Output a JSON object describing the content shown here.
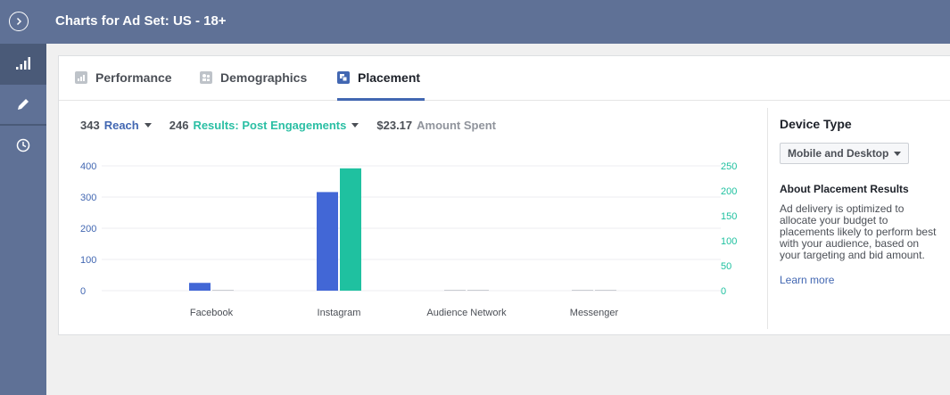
{
  "header": {
    "title": "Charts for Ad Set: US - 18+",
    "toggle_icon": "chevron-right-circle-icon"
  },
  "sidebar": {
    "items": [
      {
        "icon": "bar-chart-icon",
        "active": true
      },
      {
        "icon": "pencil-icon",
        "active": false
      },
      {
        "icon": "clock-icon",
        "active": false
      }
    ]
  },
  "tabs": [
    {
      "label": "Performance",
      "icon": "performance-icon",
      "active": false
    },
    {
      "label": "Demographics",
      "icon": "demographics-icon",
      "active": false
    },
    {
      "label": "Placement",
      "icon": "placement-icon",
      "active": true
    }
  ],
  "metrics": {
    "reach": {
      "value": "343",
      "label": "Reach",
      "color": "#4267b2"
    },
    "results": {
      "value": "246",
      "label": "Results: Post Engagements",
      "color": "#2bbfa4"
    },
    "spent": {
      "value": "$23.17",
      "label": "Amount Spent",
      "color": "#90949c"
    }
  },
  "chart_data": {
    "type": "bar",
    "categories": [
      "Facebook",
      "Instagram",
      "Audience Network",
      "Messenger"
    ],
    "series": [
      {
        "name": "Reach",
        "axis": "left",
        "color": "#4267d6",
        "values": [
          25,
          316,
          0,
          0
        ]
      },
      {
        "name": "Results: Post Engagements",
        "axis": "right",
        "color": "#1fc1a0",
        "values": [
          1,
          245,
          0,
          0
        ]
      }
    ],
    "y_left": {
      "ticks": [
        "400",
        "300",
        "200",
        "100",
        "0"
      ],
      "range": [
        0,
        400
      ]
    },
    "y_right": {
      "ticks": [
        "250",
        "200",
        "150",
        "100",
        "50",
        "0"
      ],
      "range": [
        0,
        250
      ]
    },
    "grid": true
  },
  "right_panel": {
    "device_title": "Device Type",
    "device_value": "Mobile and Desktop",
    "about_title": "About Placement Results",
    "about_text": "Ad delivery is optimized to allocate your budget to placements likely to perform best with your audience, based on your targeting and bid amount.",
    "learn_more": "Learn more"
  }
}
